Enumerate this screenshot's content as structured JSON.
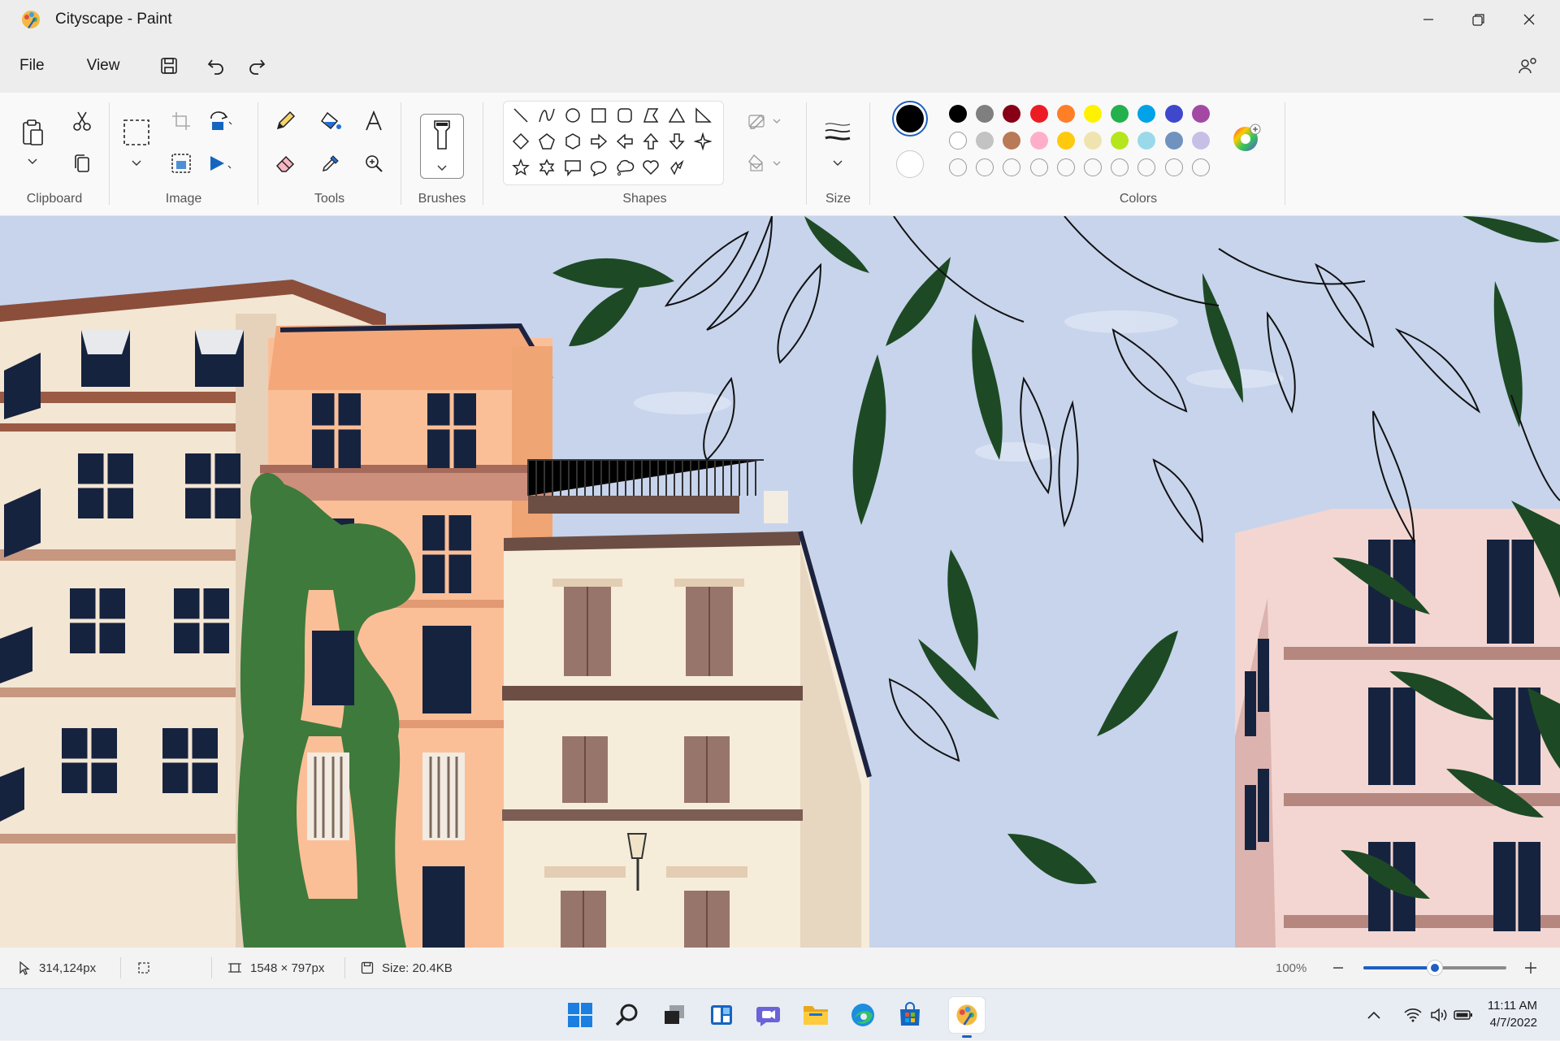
{
  "window": {
    "title": "Cityscape - Paint"
  },
  "menu": {
    "file": "File",
    "view": "View"
  },
  "ribbon": {
    "clipboard_label": "Clipboard",
    "image_label": "Image",
    "tools_label": "Tools",
    "brushes_label": "Brushes",
    "shapes_label": "Shapes",
    "size_label": "Size",
    "colors_label": "Colors"
  },
  "colors": {
    "primary": "#000000",
    "secondary": "#ffffff",
    "row1": [
      "#000000",
      "#7f7f7f",
      "#880015",
      "#ed1c24",
      "#ff7f27",
      "#fff200",
      "#22b14c",
      "#00a2e8",
      "#3f48cc",
      "#a349a4"
    ],
    "row2": [
      "#ffffff",
      "#c3c3c3",
      "#b97a57",
      "#ffaec9",
      "#ffc90e",
      "#efe4b0",
      "#b5e61d",
      "#99d9ea",
      "#7092be",
      "#c8bfe7"
    ]
  },
  "status": {
    "cursor_pos": "314,124px",
    "canvas_size": "1548 × 797px",
    "file_size": "Size: 20.4KB",
    "zoom": "100%",
    "zoom_level": 0.5
  },
  "clock": {
    "time": "11:11 AM",
    "date": "4/7/2022"
  }
}
